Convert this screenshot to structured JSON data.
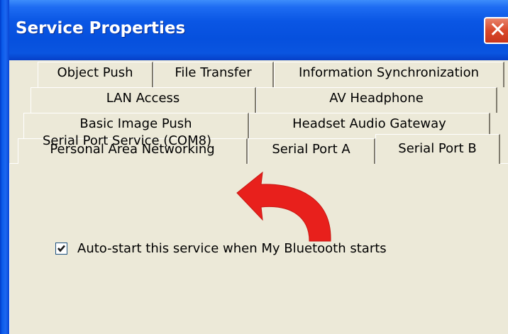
{
  "window": {
    "title": "Service Properties",
    "close_glyph": "✕"
  },
  "tabs": {
    "row1": [
      {
        "label": "Object Push"
      },
      {
        "label": "File Transfer"
      },
      {
        "label": "Information Synchronization"
      }
    ],
    "row2": [
      {
        "label": "LAN Access"
      },
      {
        "label": "AV Headphone"
      }
    ],
    "row3": [
      {
        "label": "Basic Image Push"
      },
      {
        "label": "Headset Audio Gateway"
      }
    ],
    "row4": [
      {
        "label": "Personal Area Networking"
      },
      {
        "label": "Serial Port A"
      },
      {
        "label": "Serial Port B"
      }
    ],
    "selected": "Serial Port B"
  },
  "panel": {
    "service_label": "Serial Port Service (COM8)",
    "autostart_label": "Auto-start this service when My Bluetooth starts",
    "autostart_checked": true
  },
  "colors": {
    "title_bar": "#0A56E4",
    "face": "#ECE9D8",
    "close_button": "#D9492B",
    "annotation_arrow": "#E8201C"
  },
  "icons": {
    "close": "close-icon",
    "check": "checkmark-icon",
    "annotation": "curved-arrow-icon"
  }
}
